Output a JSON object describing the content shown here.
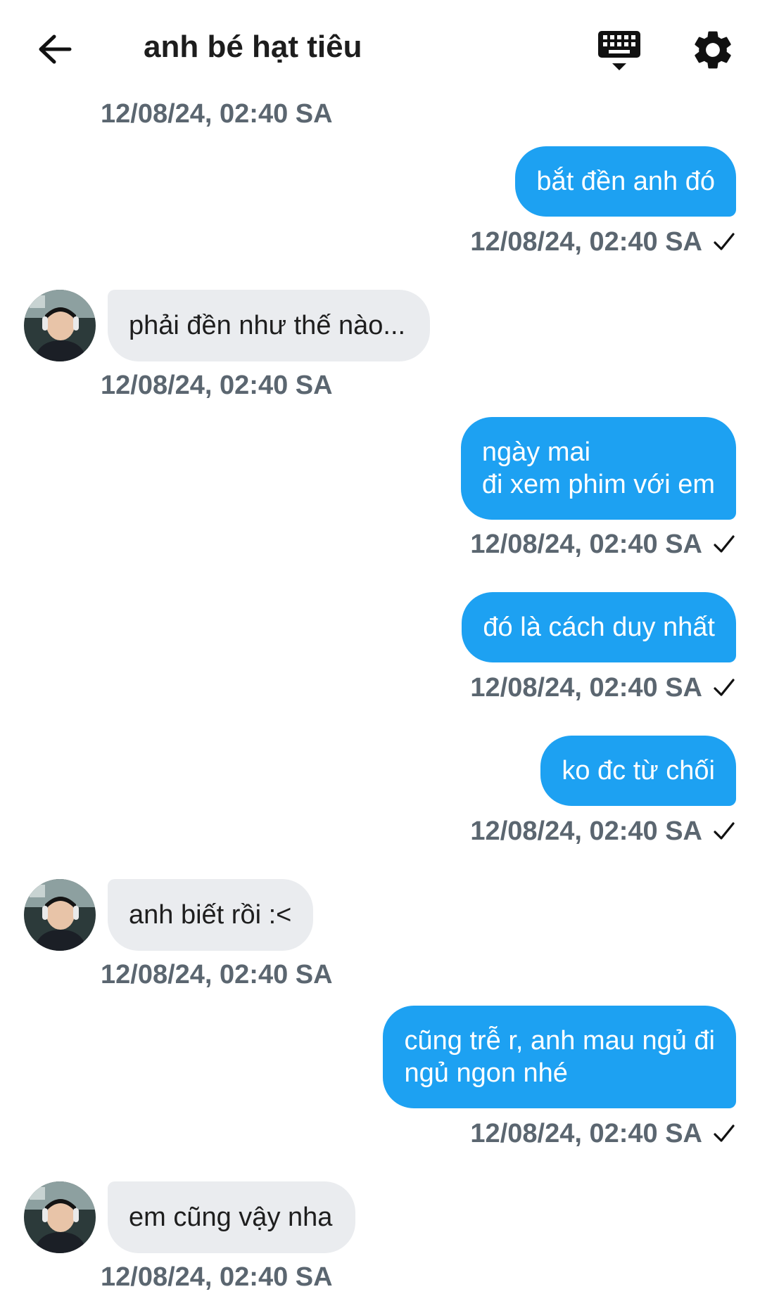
{
  "header": {
    "title": "anh bé hạt tiêu",
    "back_icon": "arrow-left-icon",
    "keyboard_icon": "keyboard-icon",
    "settings_icon": "gear-icon"
  },
  "colors": {
    "outgoing_bubble": "#1da1f2",
    "incoming_bubble": "#eaecef",
    "timestamp": "#5b6670"
  },
  "messages": [
    {
      "direction": "in_timestamp_only",
      "time": "12/08/24, 02:40 SA"
    },
    {
      "direction": "out",
      "lines": [
        "bắt đền anh đó"
      ],
      "time": "12/08/24, 02:40 SA",
      "status_icon": "check-icon"
    },
    {
      "direction": "in",
      "lines": [
        "phải đền như thế nào..."
      ],
      "time": "12/08/24, 02:40 SA"
    },
    {
      "direction": "out",
      "lines": [
        "ngày mai",
        "đi xem phim với em"
      ],
      "time": "12/08/24, 02:40 SA",
      "status_icon": "check-icon"
    },
    {
      "direction": "out",
      "lines": [
        "đó là cách duy nhất"
      ],
      "time": "12/08/24, 02:40 SA",
      "status_icon": "check-icon"
    },
    {
      "direction": "out",
      "lines": [
        "ko đc từ chối"
      ],
      "time": "12/08/24, 02:40 SA",
      "status_icon": "check-icon"
    },
    {
      "direction": "in",
      "lines": [
        "anh biết rồi :<"
      ],
      "time": "12/08/24, 02:40 SA"
    },
    {
      "direction": "out",
      "lines": [
        "cũng trễ r, anh mau ngủ đi",
        "ngủ ngon nhé"
      ],
      "time": "12/08/24, 02:40 SA",
      "status_icon": "check-icon"
    },
    {
      "direction": "in",
      "lines": [
        "em cũng vậy nha"
      ],
      "time": "12/08/24, 02:40 SA"
    }
  ]
}
